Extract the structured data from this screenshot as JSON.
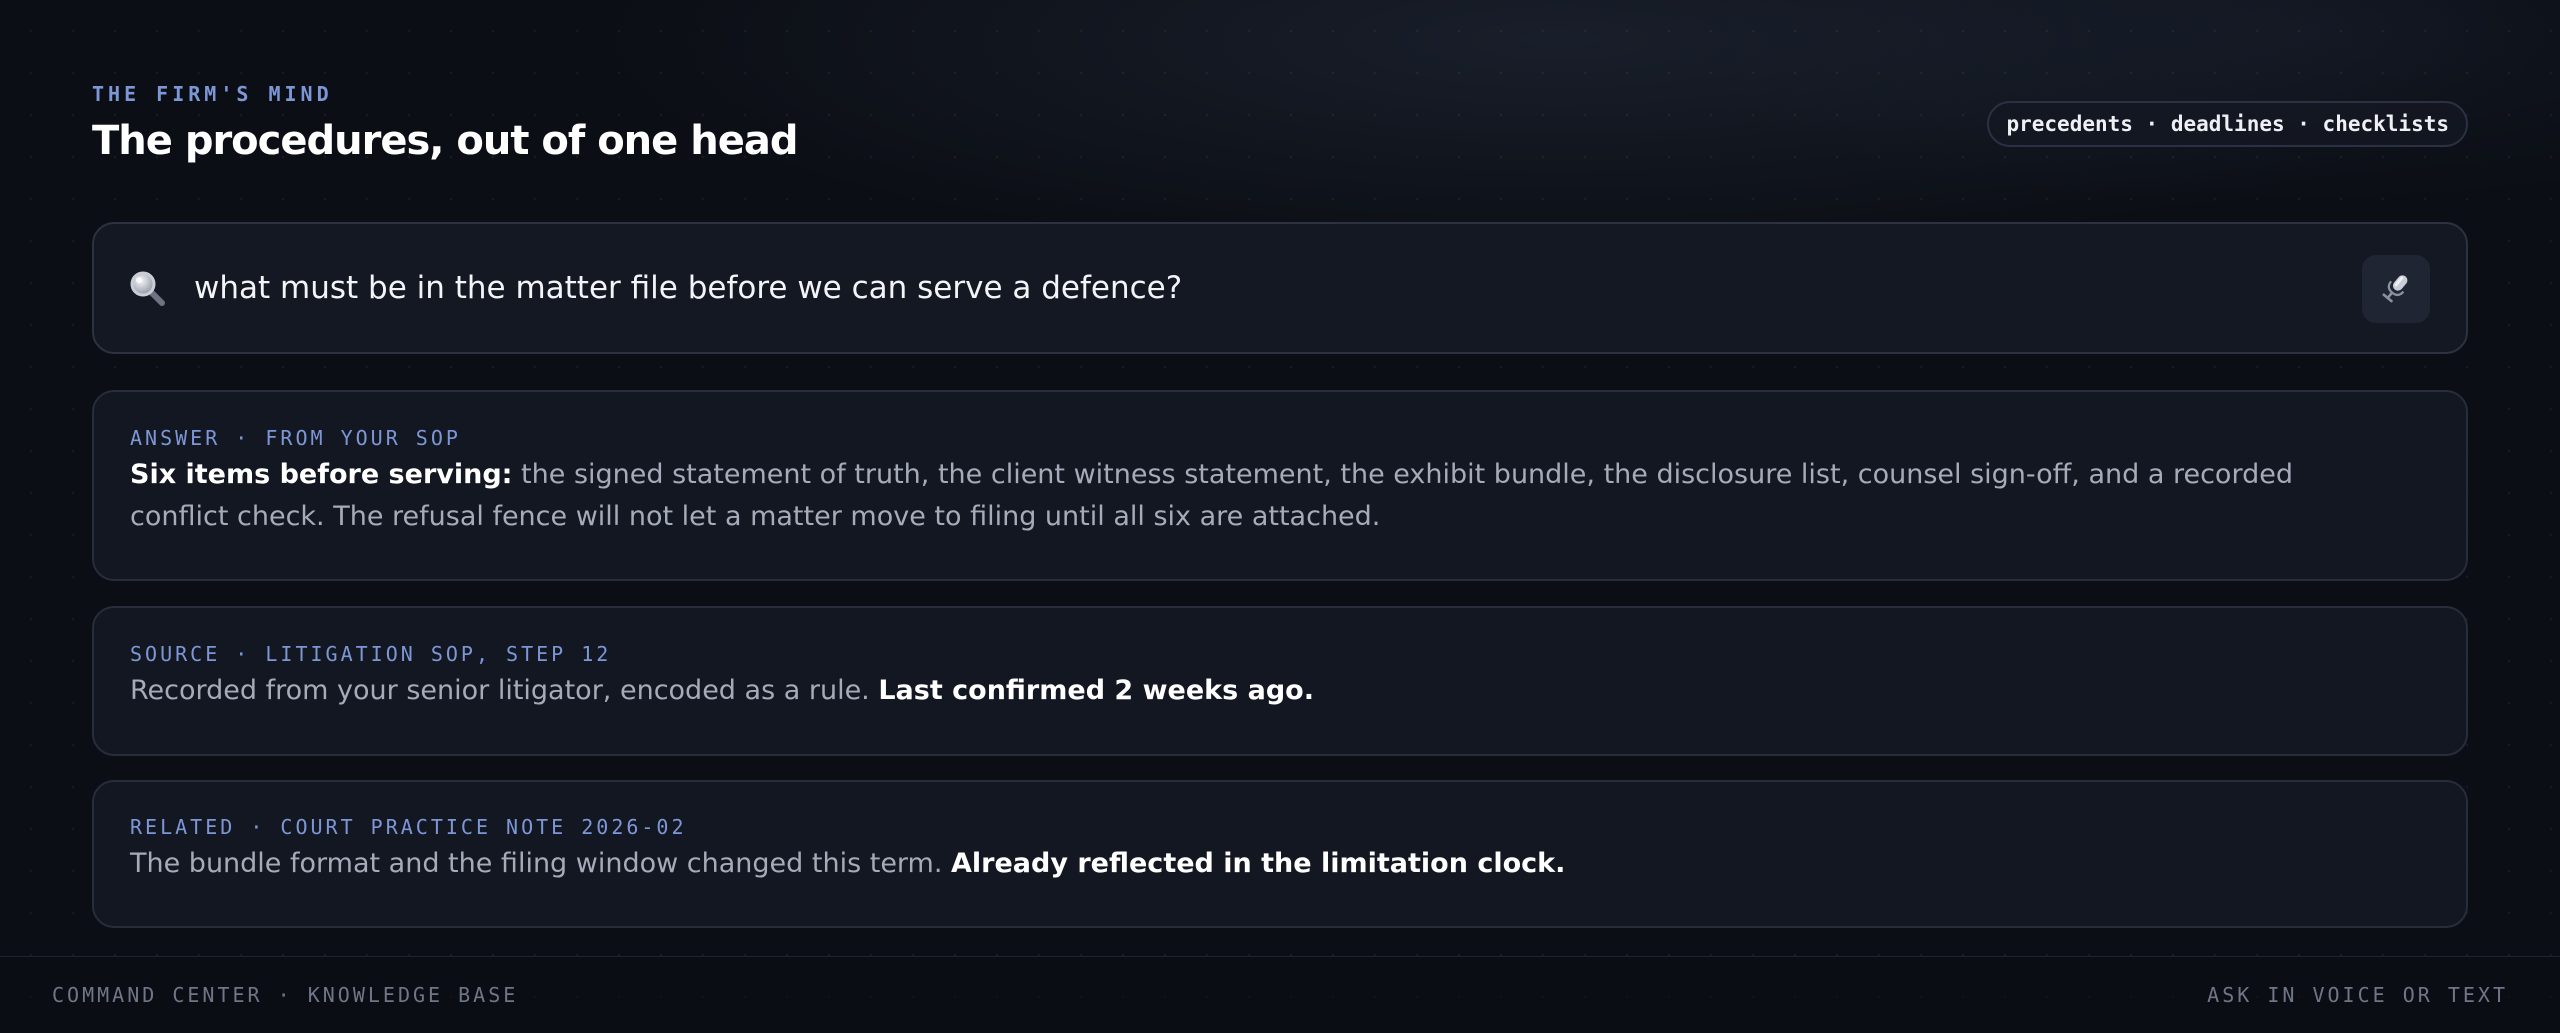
{
  "header": {
    "eyebrow": "THE FIRM'S MIND",
    "title": "The procedures, out of one head",
    "tags": "precedents · deadlines · checklists"
  },
  "search": {
    "icon": "search-icon",
    "value": "what must be in the matter file before we can serve a defence?",
    "mic_icon": "microphone-icon"
  },
  "cards": [
    {
      "label": "ANSWER · FROM YOUR SOP",
      "lead": "Six items before serving:",
      "text": " the signed statement of truth, the client witness statement, the exhibit bundle, the disclosure list, counsel sign-off, and a recorded conflict check. The refusal fence will not let a matter move to filing until all six are attached."
    },
    {
      "label": "SOURCE · LITIGATION SOP, STEP 12",
      "text": "Recorded from your senior litigator, encoded as a rule. ",
      "emphasis": "Last confirmed 2 weeks ago."
    },
    {
      "label": "RELATED · COURT PRACTICE NOTE 2026-02",
      "text": "The bundle format and the filing window changed this term. ",
      "emphasis": "Already reflected in the limitation clock."
    }
  ],
  "footer": {
    "left": "COMMAND CENTER · KNOWLEDGE BASE",
    "right": "ASK IN VOICE OR TEXT"
  },
  "colors": {
    "background": "#0b0e14",
    "accent": "#7d97d6",
    "card_bg": "#131722",
    "card_border": "#272d3a",
    "text_muted": "#a5abb8"
  }
}
